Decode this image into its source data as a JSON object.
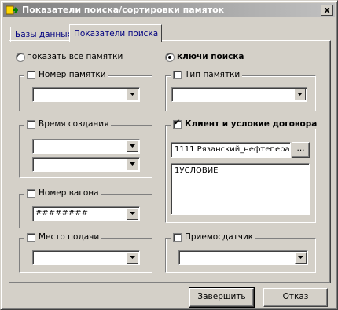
{
  "window": {
    "title": "Показатели поиска/сортировки памяток",
    "close_label": "x"
  },
  "tabs": [
    {
      "label": "Базы данных",
      "active": false
    },
    {
      "label": "Показатели поиска",
      "active": true
    }
  ],
  "mode": {
    "show_all_label": "показать все памятки",
    "search_keys_label": "ключи поиска",
    "selected": "search_keys"
  },
  "filters": {
    "memo_number": {
      "label": "Номер памятки",
      "checked": false,
      "value": ""
    },
    "creation_time": {
      "label": "Время создания",
      "checked": false,
      "from": "",
      "to": ""
    },
    "wagon_number": {
      "label": "Номер вагона",
      "checked": false,
      "value": "########"
    },
    "supply_place": {
      "label": "Место подачи",
      "checked": false,
      "value": ""
    },
    "memo_type": {
      "label": "Тип памятки",
      "checked": false,
      "value": ""
    },
    "client_contract": {
      "label": "Клиент и условие договора",
      "checked": true,
      "client_value": "1111 Рязанский_нефтепера",
      "browse_label": "...",
      "condition_value": "1УСЛОВИЕ"
    },
    "receiver": {
      "label": "Приемосдатчик",
      "checked": false,
      "value": ""
    }
  },
  "buttons": {
    "finish": "Завершить",
    "cancel": "Отказ"
  }
}
